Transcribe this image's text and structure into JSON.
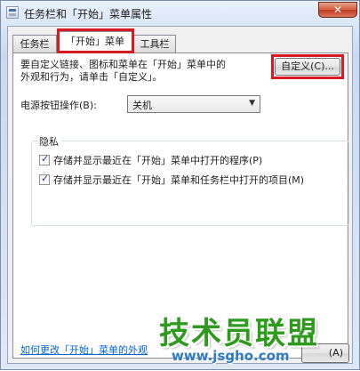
{
  "window": {
    "title": "任务栏和「开始」菜单属性",
    "close_label": "✕"
  },
  "tabs": [
    {
      "label": "任务栏"
    },
    {
      "label": "「开始」菜单"
    },
    {
      "label": "工具栏"
    }
  ],
  "start_menu": {
    "description_line1": "要自定义链接、图标和菜单在「开始」菜单中的",
    "description_line2": "外观和行为，请单击「自定义」。",
    "customize_button": "自定义(C)...",
    "power_label": "电源按钮操作(B):",
    "power_value": "关机",
    "privacy": {
      "title": "隐私",
      "items": [
        {
          "label": "存储并显示最近在「开始」菜单中打开的程序(P)",
          "checked": true
        },
        {
          "label": "存储并显示最近在「开始」菜单和任务栏中打开的项目(M)",
          "checked": true
        }
      ]
    },
    "help_link": "如何更改「开始」菜单的外观",
    "partial_button": "(A)"
  },
  "watermark": {
    "main": "技术员联盟",
    "sub": "www.jsgho.com"
  },
  "colors": {
    "highlight_box": "#d91921",
    "link": "#0066cc",
    "watermark_green": "#2e9b1e",
    "watermark_blue": "#2e7bc4"
  }
}
